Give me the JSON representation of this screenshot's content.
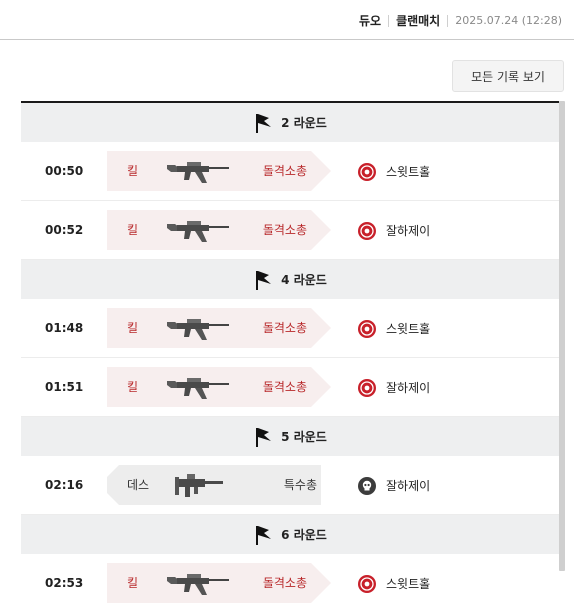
{
  "header": {
    "mode": "듀오",
    "match_type": "클랜매치",
    "datetime": "2025.07.24 (12:28)"
  },
  "all_records_button": "모든 기록 보기",
  "rounds": [
    {
      "label": "2 라운드",
      "events": [
        {
          "time": "00:50",
          "type": "kill",
          "action": "킬",
          "weapon_icon": "assault-rifle-icon",
          "weapon_class": "돌격소총",
          "player_icon": "target-icon",
          "player": "스윗트홀"
        },
        {
          "time": "00:52",
          "type": "kill",
          "action": "킬",
          "weapon_icon": "assault-rifle-icon",
          "weapon_class": "돌격소총",
          "player_icon": "target-icon",
          "player": "잘하제이"
        }
      ]
    },
    {
      "label": "4 라운드",
      "events": [
        {
          "time": "01:48",
          "type": "kill",
          "action": "킬",
          "weapon_icon": "assault-rifle-icon",
          "weapon_class": "돌격소총",
          "player_icon": "target-icon",
          "player": "스윗트홀"
        },
        {
          "time": "01:51",
          "type": "kill",
          "action": "킬",
          "weapon_icon": "assault-rifle-icon",
          "weapon_class": "돌격소총",
          "player_icon": "target-icon",
          "player": "잘하제이"
        }
      ]
    },
    {
      "label": "5 라운드",
      "events": [
        {
          "time": "02:16",
          "type": "death",
          "action": "데스",
          "weapon_icon": "smg-icon",
          "weapon_class": "특수총",
          "player_icon": "skull-icon",
          "player": "잘하제이"
        }
      ]
    },
    {
      "label": "6 라운드",
      "events": [
        {
          "time": "02:53",
          "type": "kill",
          "action": "킬",
          "weapon_icon": "assault-rifle-icon",
          "weapon_class": "돌격소총",
          "player_icon": "target-icon",
          "player": "스윗트홀"
        }
      ]
    }
  ],
  "colors": {
    "kill_text": "#b8282a",
    "kill_card": "#f7eeee",
    "death_card": "#ededed",
    "round_header_bg": "#eeeff0"
  }
}
